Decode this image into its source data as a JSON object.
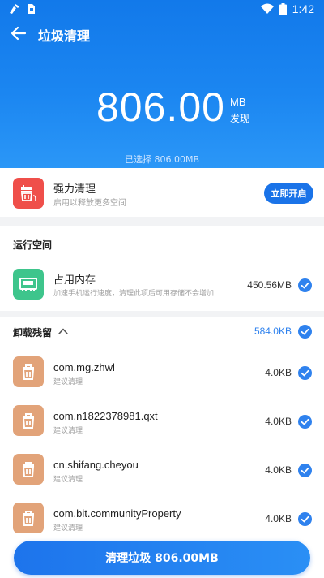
{
  "status_bar": {
    "time": "1:42"
  },
  "header": {
    "title": "垃圾清理",
    "size_value": "806.00",
    "size_unit": "MB",
    "size_found_label": "发现",
    "selected_text": "已选择 806.00MB"
  },
  "power_clean": {
    "title": "强力清理",
    "subtitle": "启用以释放更多空间",
    "button_label": "立即开启"
  },
  "running_space": {
    "section_title": "运行空间",
    "item": {
      "title": "占用内存",
      "subtitle": "加速手机运行速度，清理此项后可用存储不会增加",
      "size": "450.56MB",
      "checked": true
    }
  },
  "residue": {
    "section_title": "卸载残留",
    "total": "584.0KB",
    "items": [
      {
        "name": "com.mg.zhwl",
        "subtitle": "建议清理",
        "size": "4.0KB",
        "checked": true
      },
      {
        "name": "com.n1822378981.qxt",
        "subtitle": "建议清理",
        "size": "4.0KB",
        "checked": true
      },
      {
        "name": "cn.shifang.cheyou",
        "subtitle": "建议清理",
        "size": "4.0KB",
        "checked": true
      },
      {
        "name": "com.bit.communityProperty",
        "subtitle": "建议清理",
        "size": "4.0KB",
        "checked": true
      }
    ]
  },
  "footer": {
    "clean_button_label": "清理垃圾 806.00MB"
  },
  "colors": {
    "primary": "#1a73e8",
    "check": "#2f82ee",
    "power_icon": "#ef4f4a",
    "memory_icon": "#3ec58c",
    "residue_icon": "#e2a379"
  }
}
